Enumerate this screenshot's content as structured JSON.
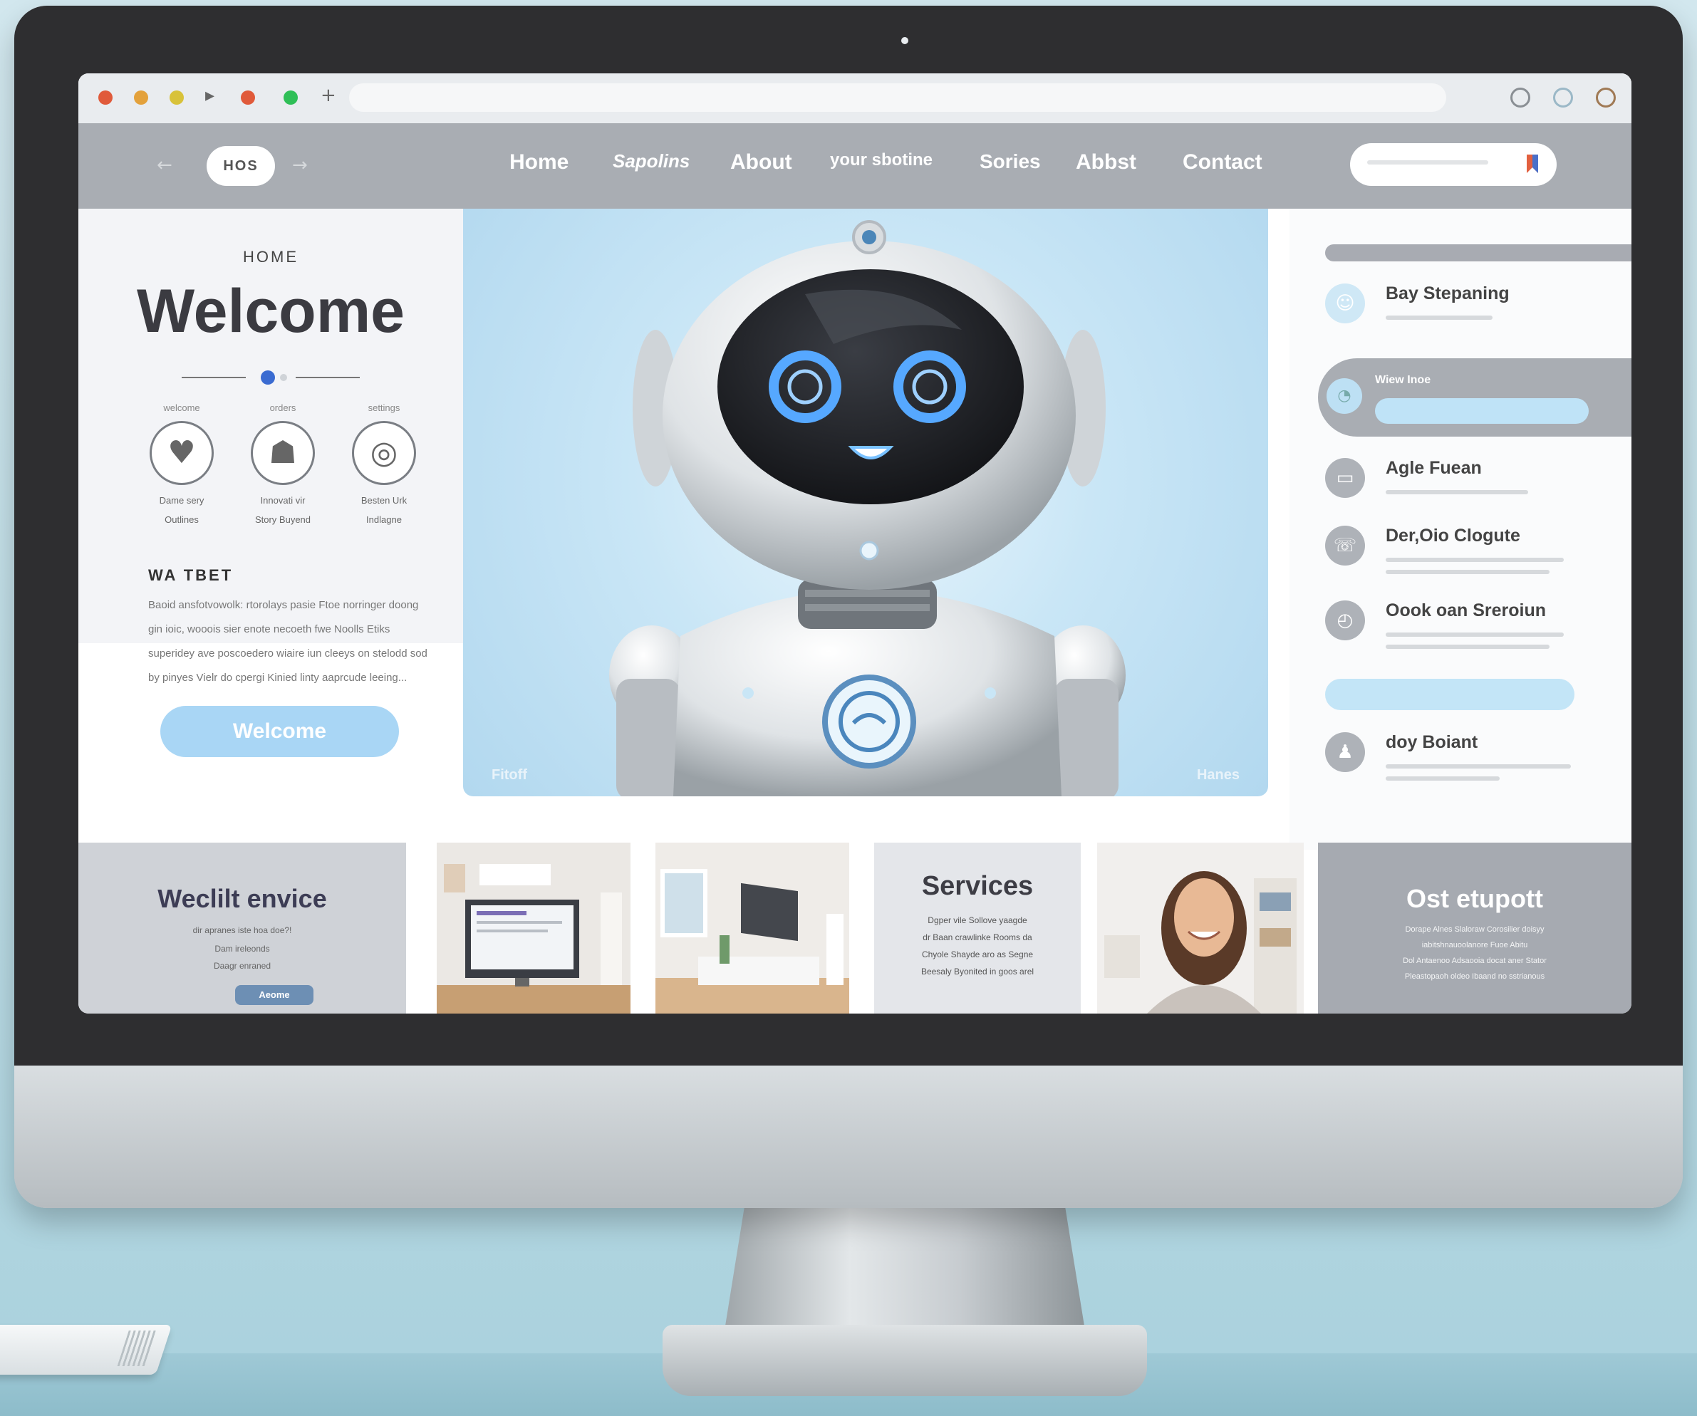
{
  "browser": {
    "toolbar_dots": [
      "#e05a3a",
      "#e3a13b",
      "#d8c23a",
      "#2fbf57"
    ],
    "toolbar_glyphs": [
      "▸",
      "+"
    ]
  },
  "site": {
    "logo": "HOS",
    "nav": [
      {
        "label": "Home"
      },
      {
        "label": "Sapolins"
      },
      {
        "label": "About"
      },
      {
        "label": "your sbotine"
      },
      {
        "label": "Sories"
      },
      {
        "label": "Abbst"
      },
      {
        "label": "Contact"
      }
    ],
    "search": {
      "placeholder": "",
      "icon": "bookmark-icon"
    }
  },
  "left": {
    "kicker": "HOME",
    "title": "Welcome",
    "features": [
      {
        "caption": "welcome",
        "icon": "heart-icon",
        "sub1": "Dame sery",
        "sub2": "Outlines"
      },
      {
        "caption": "orders",
        "icon": "person-icon",
        "sub1": "Innovati vir",
        "sub2": "Story Buyend"
      },
      {
        "caption": "settings",
        "icon": "ring-icon",
        "sub1": "Besten Urk",
        "sub2": "Indlagne"
      }
    ],
    "heading": "WA TBET",
    "body": "Baoid ansfotvowolk: rtorolays pasie Ftoe norringer doong gin ioic, wooois sier enote necoeth fwe Noolls Etiks superidey ave poscoedero wiaire iun cleeys on stelodd sod by pinyes Vielr do cpergi Kinied linty aaprcude leeing...",
    "button": "Welcome"
  },
  "hero": {
    "caption_left": "Fitoff",
    "caption_right": "Hanes"
  },
  "right": {
    "items": [
      {
        "title": "Bay Stepaning",
        "icon": "person-icon"
      },
      {
        "title": "Wiew Inoe",
        "icon": "clock-icon",
        "active": true
      },
      {
        "title": "Agle Fuean",
        "icon": "bed-icon"
      },
      {
        "title": "Der,Oio Clogute",
        "icon": "chat-icon"
      },
      {
        "title": "Oook oan Sreroiun",
        "icon": "clock-icon"
      },
      {
        "title": "doy Boiant",
        "icon": "user-icon"
      }
    ],
    "pill_label": "",
    "footer": ""
  },
  "cards": [
    {
      "title": "Weclilt envice",
      "lines": [
        "dir apranes iste hoa doe?!",
        "Dam ireleonds",
        "Daagr enraned"
      ],
      "button": "Aeome"
    },
    {
      "title": "",
      "kind": "office-photo"
    },
    {
      "title": "",
      "kind": "living-photo"
    },
    {
      "title": "Services",
      "lines": [
        "Dgper vile Sollove yaagde",
        "dr Baan crawlinke Rooms da",
        "Chyole Shayde aro as Segne",
        "Beesaly Byonited in goos arel"
      ]
    },
    {
      "title": "",
      "kind": "person-photo"
    },
    {
      "title": "Ost etupott",
      "lines": [
        "Dorape Alnes Slaloraw Corosilier doisyy",
        "iabitshnauoolanore Fuoe Abitu",
        "Dol Antaenoo Adsaooia docat aner Stator",
        "Pleastopaoh oldeo Ibaand no sstrianous"
      ]
    }
  ]
}
